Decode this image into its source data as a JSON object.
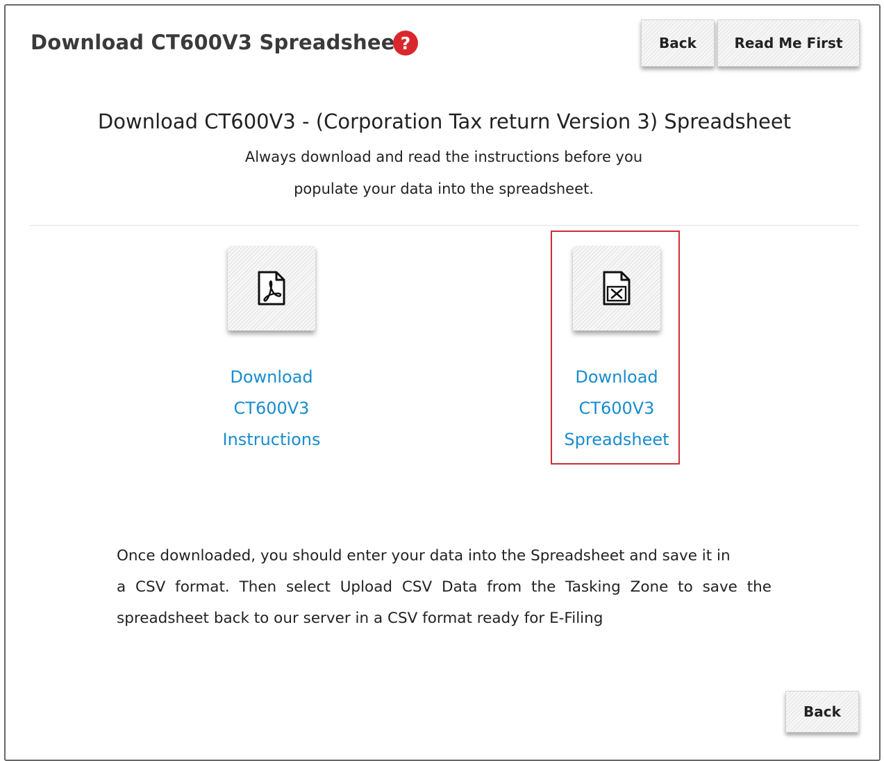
{
  "header": {
    "title": "Download CT600V3 Spreadsheet",
    "back_label": "Back",
    "read_me_label": "Read Me First"
  },
  "intro": {
    "heading": "Download CT600V3 - (Corporation Tax return Version 3) Spreadsheet",
    "line1": "Always download and read the instructions before you",
    "line2": "populate your data into the spreadsheet."
  },
  "downloads": [
    {
      "icon": "pdf-file-icon",
      "lines": [
        "Download",
        "CT600V3",
        "Instructions"
      ]
    },
    {
      "icon": "excel-file-icon",
      "lines": [
        "Download",
        "CT600V3",
        "Spreadsheet"
      ]
    }
  ],
  "info": {
    "line1": "Once downloaded, you should enter your data into the Spreadsheet and save it in",
    "line2": "a CSV format. Then select Upload CSV Data from the Tasking Zone to save the",
    "line3": "spreadsheet back to our server in a CSV format ready for E-Filing"
  },
  "footer": {
    "back_label": "Back"
  },
  "colors": {
    "link": "#1a8ccc",
    "help_icon": "#d9272e",
    "highlight_border": "#cc2f35",
    "title_text": "#3a3a3a"
  }
}
